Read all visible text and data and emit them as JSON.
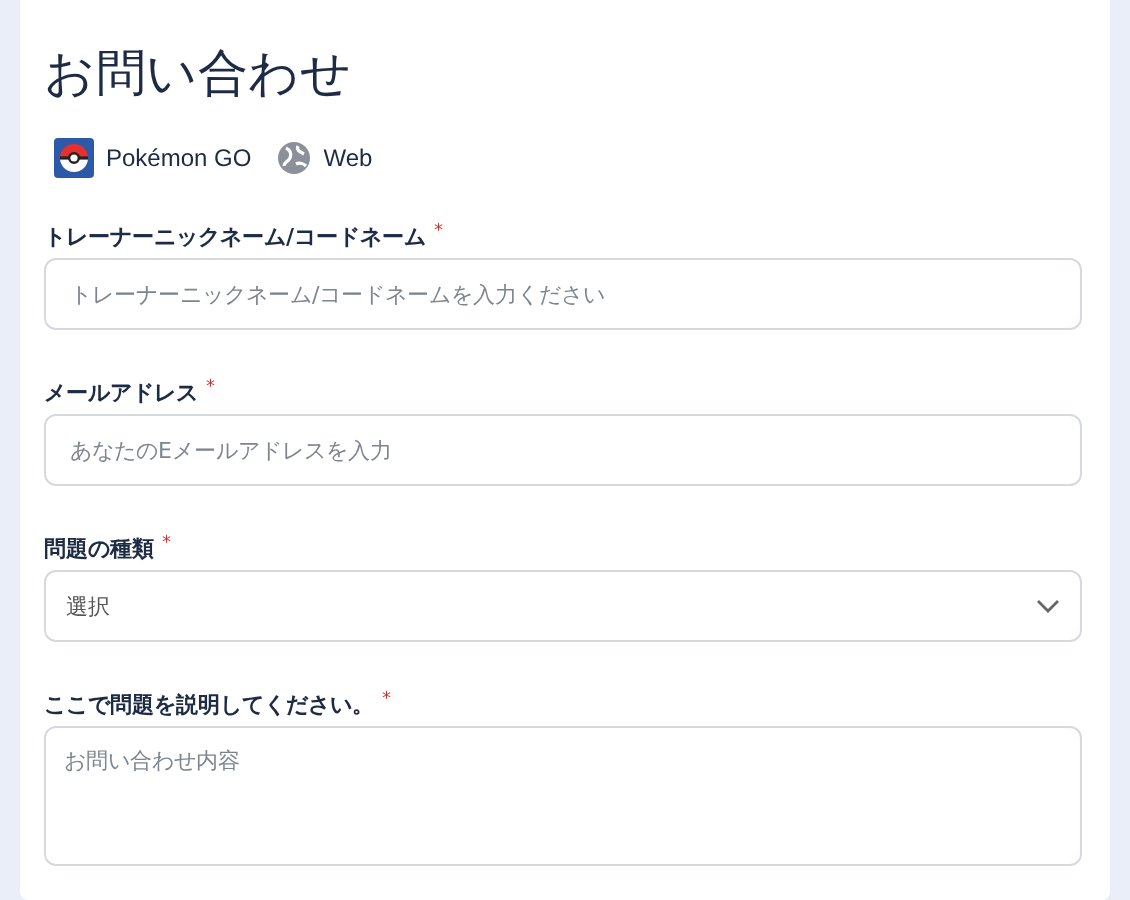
{
  "title": "お問い合わせ",
  "platforms": [
    {
      "kind": "app",
      "label": "Pokémon GO"
    },
    {
      "kind": "web",
      "label": "Web"
    }
  ],
  "fields": [
    {
      "kind": "text",
      "label": "トレーナーニックネーム/コードネーム",
      "required_mark": "*",
      "placeholder": "トレーナーニックネーム/コードネームを入力ください"
    },
    {
      "kind": "text",
      "label": "メールアドレス",
      "required_mark": "*",
      "placeholder": "あなたのEメールアドレスを入力"
    },
    {
      "kind": "select",
      "label": "問題の種類",
      "required_mark": "*",
      "value": "選択"
    },
    {
      "kind": "textarea",
      "label": "ここで問題を説明してください。",
      "required_mark": "*",
      "placeholder": "お問い合わせ内容"
    }
  ]
}
